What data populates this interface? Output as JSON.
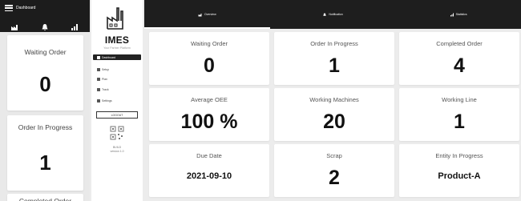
{
  "mobile": {
    "menu_label": "Dashboard",
    "cards": [
      {
        "label": "Waiting Order",
        "value": "0"
      },
      {
        "label": "Order In Progress",
        "value": "1"
      },
      {
        "label": "Completed Order",
        "value": ""
      }
    ]
  },
  "sidebar": {
    "brand": "IMES",
    "tagline": "Your Partner Platform",
    "nav": [
      {
        "label": "Dashboard",
        "icon": "dashboard-icon"
      },
      {
        "label": "Setup",
        "icon": "wrench-icon"
      },
      {
        "label": "Plan",
        "icon": "calendar-icon"
      },
      {
        "label": "Track",
        "icon": "chart-icon"
      },
      {
        "label": "Settings",
        "icon": "settings-icon"
      }
    ],
    "logout_label": "LOGOUT",
    "build_line1": "BUILD",
    "build_line2": "version 1.0"
  },
  "desktop": {
    "tabs": [
      {
        "label": "Overview",
        "icon": "factory-icon",
        "active": true
      },
      {
        "label": "Notification",
        "icon": "bell-icon",
        "active": false
      },
      {
        "label": "Statistics",
        "icon": "bar-chart-icon",
        "active": false
      }
    ],
    "cards": [
      {
        "label": "Waiting Order",
        "value": "0",
        "size": "big"
      },
      {
        "label": "Order In Progress",
        "value": "1",
        "size": "big"
      },
      {
        "label": "Completed Order",
        "value": "4",
        "size": "big"
      },
      {
        "label": "Average OEE",
        "value": "100 %",
        "size": "big"
      },
      {
        "label": "Working Machines",
        "value": "20",
        "size": "big"
      },
      {
        "label": "Working Line",
        "value": "1",
        "size": "big"
      },
      {
        "label": "Due Date",
        "value": "2021-09-10",
        "size": "small"
      },
      {
        "label": "Scrap",
        "value": "2",
        "size": "big"
      },
      {
        "label": "Entity In Progress",
        "value": "Product-A",
        "size": "small"
      }
    ]
  },
  "colors": {
    "topbar": "#1e1e1e",
    "background": "#ececec",
    "card": "#ffffff",
    "text": "#111111"
  }
}
